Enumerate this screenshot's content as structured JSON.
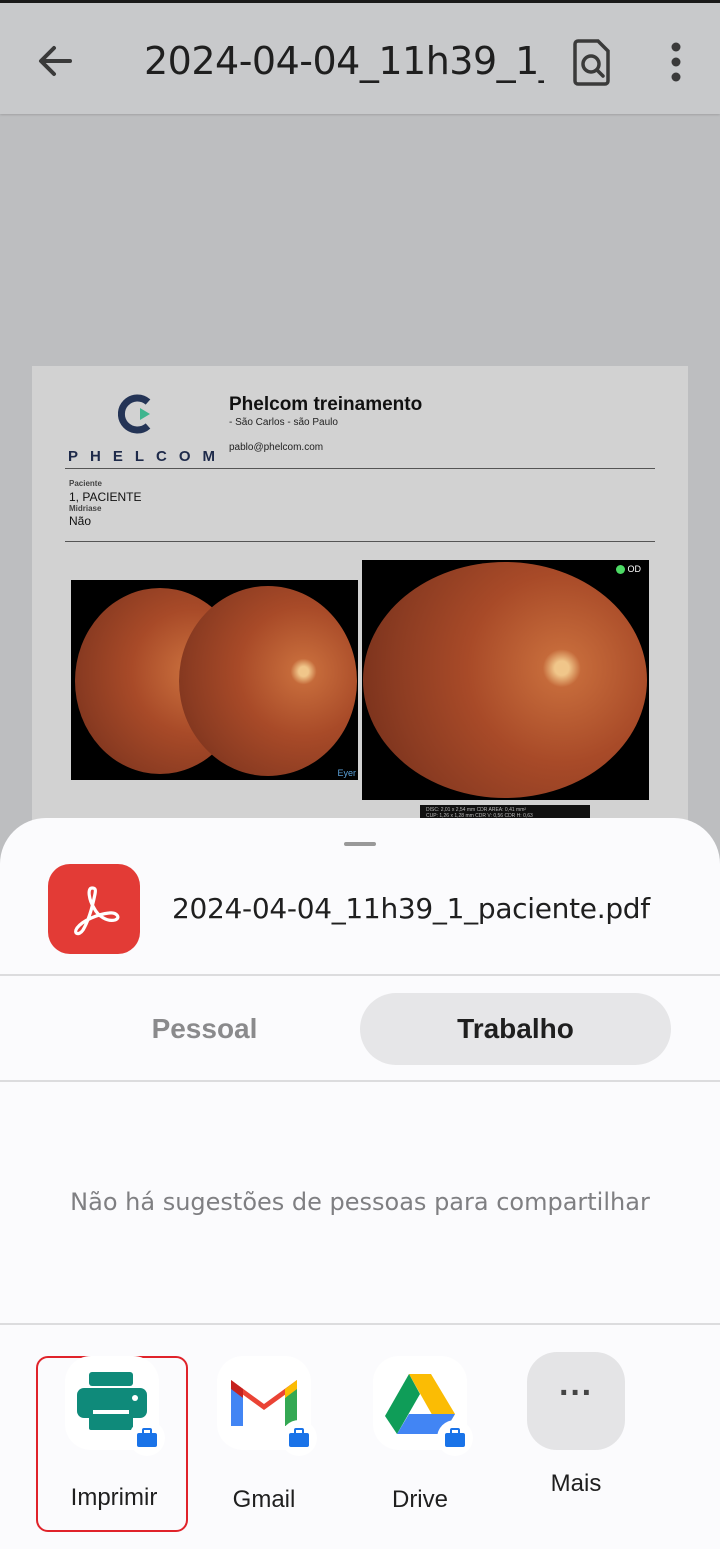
{
  "toolbar": {
    "title": "2024-04-04_11h39_1_...",
    "back_icon": "arrow-left-icon",
    "find_icon": "find-in-page-icon",
    "more_icon": "more-vertical-icon"
  },
  "document_preview": {
    "logo_word": "PHELCOM",
    "org_name": "Phelcom treinamento",
    "org_address": "- São Carlos - são Paulo",
    "org_email": "pablo@phelcom.com",
    "patient_label": "Paciente",
    "patient_value": "1, PACIENTE",
    "midriase_label": "Midriase",
    "midriase_value": "Não",
    "eye_badge": "OD",
    "eyer_tag": "Eyer",
    "metrics_line1": "DISC: 2,01 x 2,54 mm   CDR AREA: 0,41 mm²",
    "metrics_line2": "CUP: 1,26 x 1,28 mm   CDR V: 0,56   CDR H: 0,63"
  },
  "share_sheet": {
    "file_name": "2024-04-04_11h39_1_paciente.pdf",
    "file_icon": "adobe-pdf-icon",
    "tabs": [
      {
        "label": "Pessoal",
        "selected": false
      },
      {
        "label": "Trabalho",
        "selected": true
      }
    ],
    "empty_message": "Não há sugestões de pessoas para compartilhar",
    "apps": [
      {
        "label": "Imprimir",
        "icon": "printer-icon",
        "highlighted": true
      },
      {
        "label": "Gmail",
        "icon": "gmail-icon"
      },
      {
        "label": "Drive",
        "icon": "google-drive-icon"
      },
      {
        "label": "Mais",
        "icon": "more-horizontal-icon"
      }
    ]
  },
  "colors": {
    "pdf_red": "#e33b36",
    "highlight_border": "#e0232a",
    "print_teal": "#0f8a7a",
    "work_badge_blue": "#1a73e8"
  }
}
